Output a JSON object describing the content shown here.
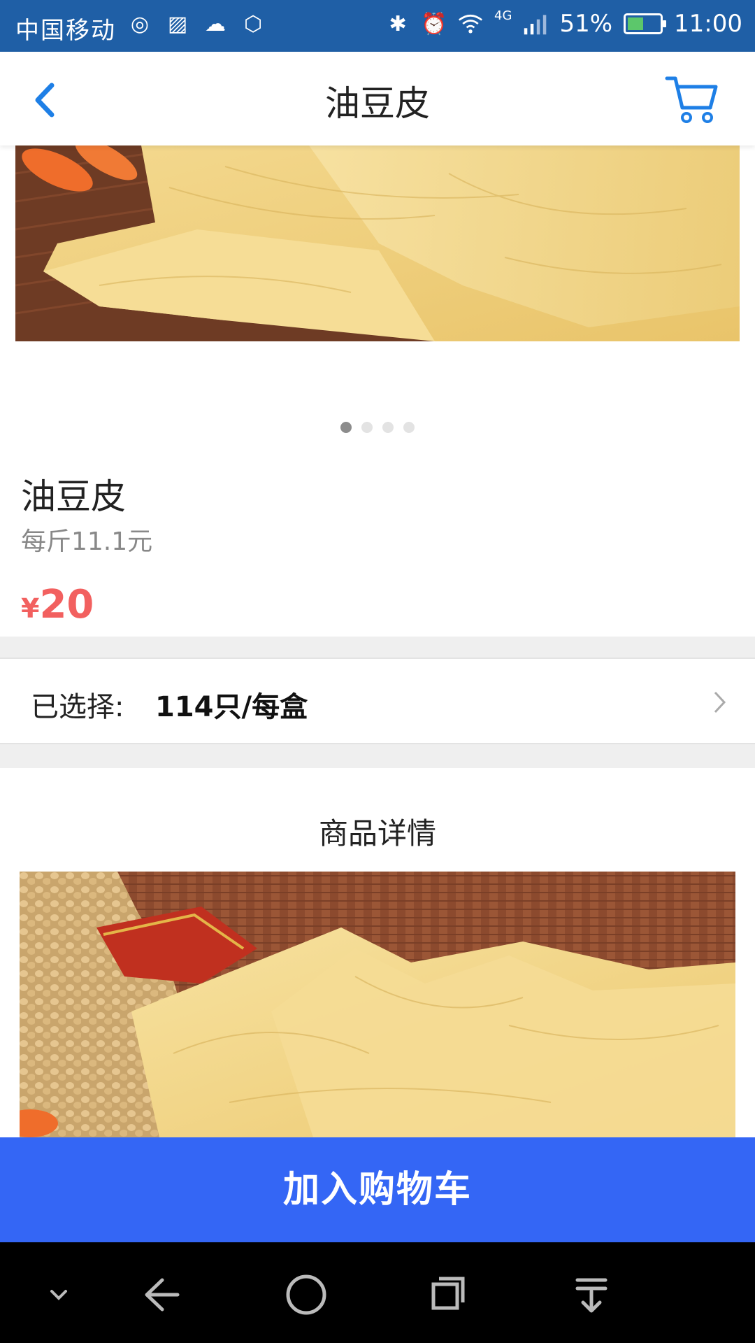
{
  "status_bar": {
    "carrier": "中国移动",
    "network": "4G",
    "battery": "51%",
    "battery_level": 0.51,
    "time": "11:00"
  },
  "header": {
    "title": "油豆皮",
    "back_icon": "back-arrow-icon",
    "cart_icon": "shopping-cart-icon",
    "accent_color": "#1e7fe6"
  },
  "carousel": {
    "page_count": 4,
    "active_index": 0
  },
  "product": {
    "name": "油豆皮",
    "unit_price": "每斤11.1元",
    "currency": "¥",
    "price": "20",
    "price_color": "#f2605f"
  },
  "selection": {
    "label": "已选择:",
    "value": "114只/每盒"
  },
  "details": {
    "title": "商品详情"
  },
  "actions": {
    "add_to_cart": "加入购物车",
    "button_color": "#3466f5"
  }
}
